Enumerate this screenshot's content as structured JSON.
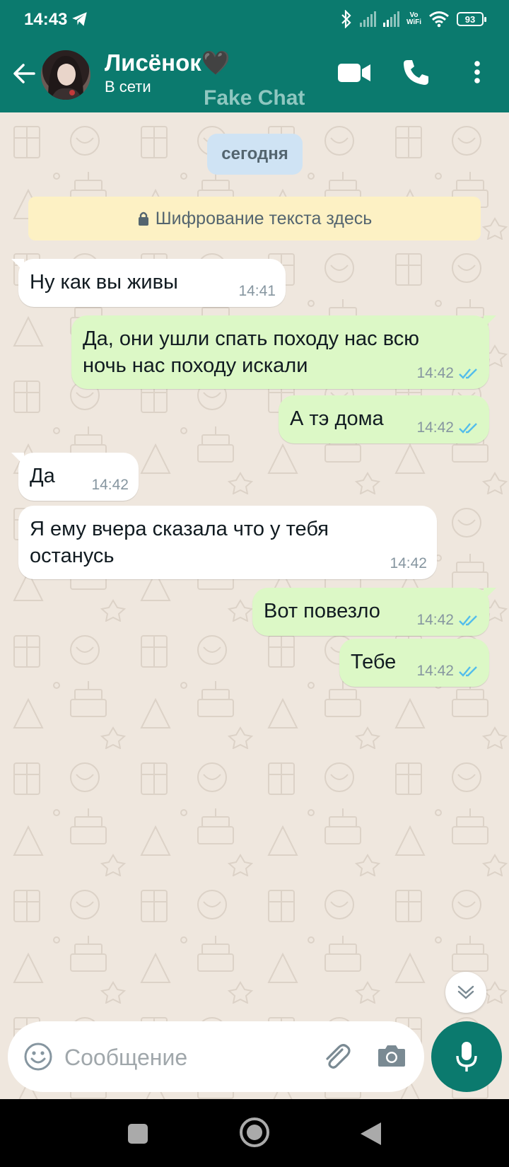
{
  "status_bar": {
    "time": "14:43",
    "volte_top": "Vo",
    "volte_bottom": "WiFi",
    "battery": "93"
  },
  "header": {
    "contact_name": "Лисёнок🖤",
    "status": "В сети",
    "watermark": "Fake Chat"
  },
  "chat": {
    "date_chip": "сегодня",
    "encryption_notice": "Шифрование текста здесь",
    "messages": [
      {
        "direction": "in",
        "text_lines": [
          "Ну как вы живы"
        ],
        "time": "14:41"
      },
      {
        "direction": "out",
        "text_lines": [
          "Да, они ушли спать походу нас всю",
          "ночь нас походу искали"
        ],
        "time": "14:42",
        "read": true
      },
      {
        "direction": "out",
        "text_lines": [
          "А тэ дома"
        ],
        "time": "14:42",
        "read": true
      },
      {
        "direction": "in",
        "text_lines": [
          "Да"
        ],
        "time": "14:42"
      },
      {
        "direction": "in",
        "text_lines": [
          "Я ему вчера сказала что у тебя",
          "останусь"
        ],
        "time": "14:42"
      },
      {
        "direction": "out",
        "text_lines": [
          "Вот повезло"
        ],
        "time": "14:42",
        "read": true
      },
      {
        "direction": "out",
        "text_lines": [
          "Тебе"
        ],
        "time": "14:42",
        "read": true
      }
    ]
  },
  "composer": {
    "placeholder": "Сообщение"
  },
  "colors": {
    "header": "#0b7a6e",
    "chat_bg": "#efe7de",
    "bubble_in": "#ffffff",
    "bubble_out": "#dcf8c6",
    "read_ticks": "#53bdeb"
  }
}
